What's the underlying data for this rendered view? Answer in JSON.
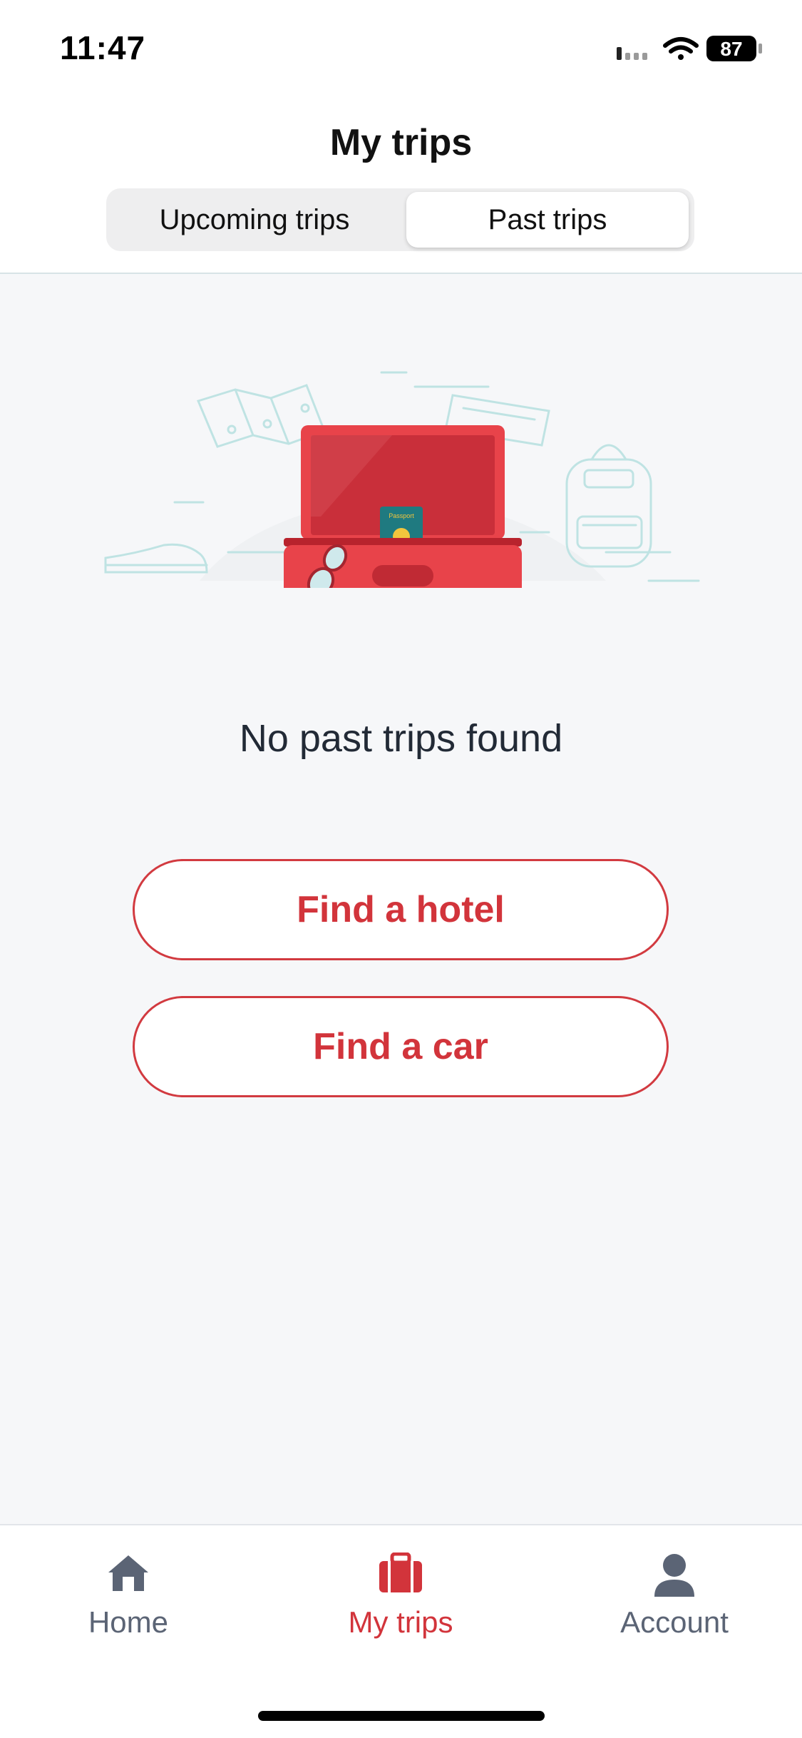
{
  "status_bar": {
    "time": "11:47",
    "battery": "87",
    "icons": [
      "signal-icon",
      "wifi-icon",
      "battery-icon"
    ]
  },
  "header": {
    "title": "My trips",
    "segments": [
      {
        "label": "Upcoming trips",
        "selected": false
      },
      {
        "label": "Past trips",
        "selected": true
      }
    ]
  },
  "empty_state": {
    "illustration": "open-suitcase-illustration",
    "passport_text": "Passport",
    "message": "No past trips found"
  },
  "actions": {
    "find_hotel": "Find a hotel",
    "find_car": "Find a car"
  },
  "tabbar": {
    "items": [
      {
        "label": "Home",
        "icon": "home-icon",
        "active": false
      },
      {
        "label": "My trips",
        "icon": "suitcase-icon",
        "active": true
      },
      {
        "label": "Account",
        "icon": "person-icon",
        "active": false
      }
    ]
  },
  "colors": {
    "accent": "#d2343b",
    "background": "#f6f7f9",
    "line_art": "#bfe3e3",
    "inactive": "#5b6475"
  }
}
